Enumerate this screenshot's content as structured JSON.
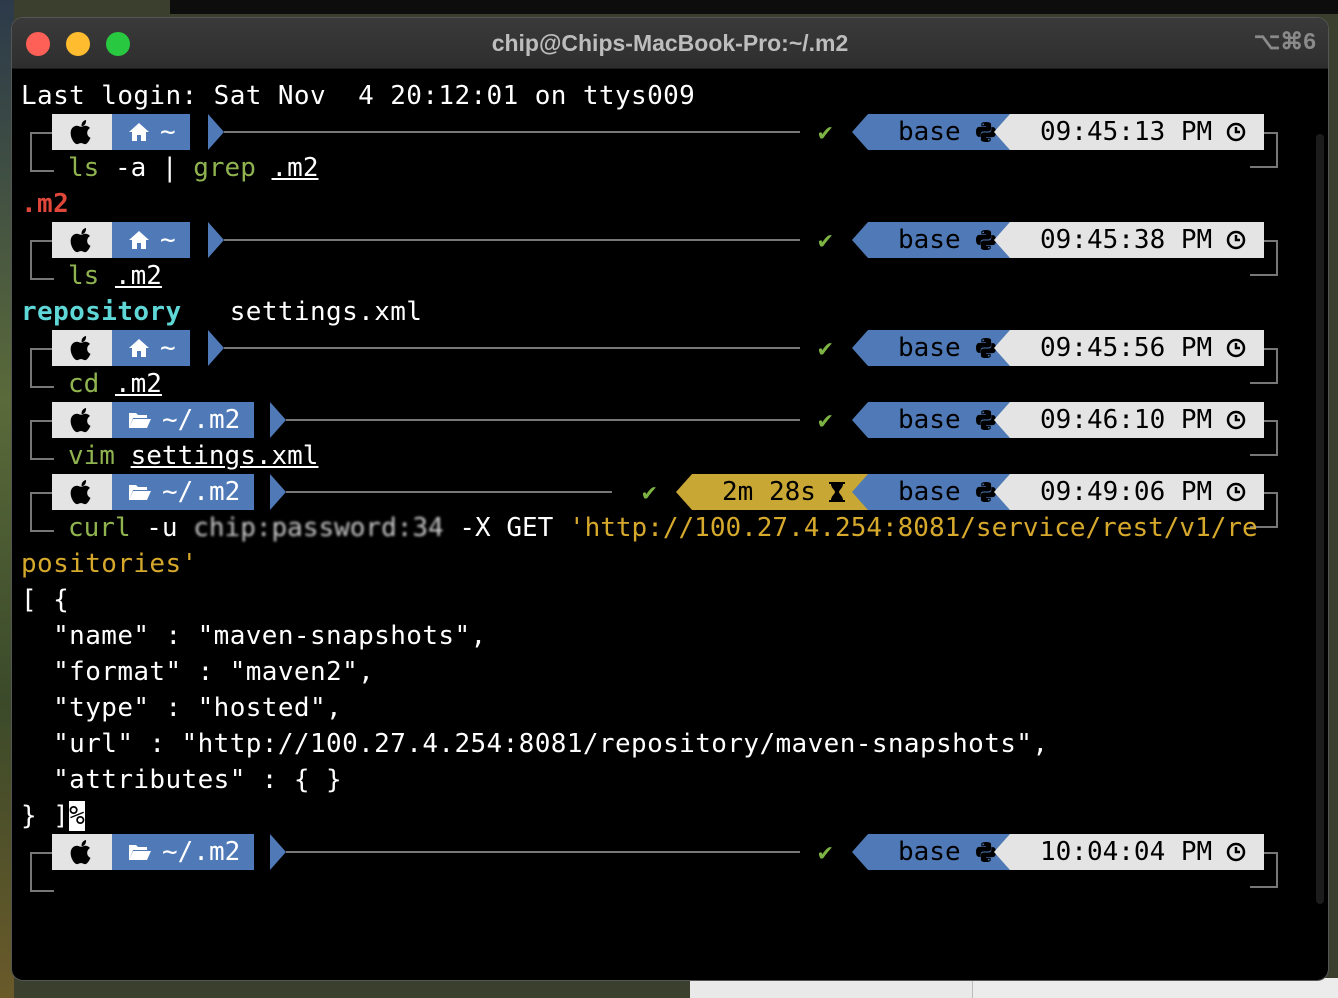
{
  "window": {
    "title": "chip@Chips-MacBook-Pro:~/.m2",
    "shortcut": "⌥⌘6"
  },
  "login_line": "Last login: Sat Nov  4 20:12:01 on ttys009",
  "env": "base",
  "prompts": [
    {
      "dir": "~",
      "dir_icon": "home-icon",
      "time": "09:45:13 PM",
      "cmd": [
        "ls",
        " -a | ",
        "grep",
        " ",
        ".m2"
      ]
    },
    {
      "dir": "~",
      "dir_icon": "home-icon",
      "time": "09:45:38 PM",
      "cmd": [
        "ls",
        " ",
        ".m2"
      ]
    },
    {
      "dir": "~",
      "dir_icon": "home-icon",
      "time": "09:45:56 PM",
      "cmd": [
        "cd",
        " ",
        ".m2"
      ]
    },
    {
      "dir": "~/.m2",
      "dir_icon": "folder-open-icon",
      "time": "09:46:10 PM",
      "cmd": [
        "vim",
        " ",
        "settings.xml"
      ]
    },
    {
      "dir": "~/.m2",
      "dir_icon": "folder-open-icon",
      "time": "09:49:06 PM",
      "duration": "2m 28s",
      "cmd": [
        "curl",
        " -u ",
        "chip:password:34",
        " -X GET ",
        "'http://100.27.4.254:8081/service/rest/v1/re"
      ]
    },
    {
      "dir": "~/.m2",
      "dir_icon": "folder-open-icon",
      "time": "10:04:04 PM"
    }
  ],
  "outputs": {
    "grep_result": ".m2",
    "ls_dir": "repository",
    "ls_file": "settings.xml",
    "curl_wrap": "positories'",
    "json_lines": [
      "[ {",
      "  \"name\" : \"maven-snapshots\",",
      "  \"format\" : \"maven2\",",
      "  \"type\" : \"hosted\",",
      "  \"url\" : \"http://100.27.4.254:8081/repository/maven-snapshots\",",
      "  \"attributes\" : { }",
      "} ]"
    ],
    "eol_mark": "%"
  },
  "colors": {
    "segment_blue": "#4f7ab7",
    "segment_light": "#e4e4e4",
    "duration_yellow": "#c9a735",
    "command_green": "#8fb34f",
    "string_yellow": "#d6a92c",
    "check_green": "#7cb342"
  }
}
